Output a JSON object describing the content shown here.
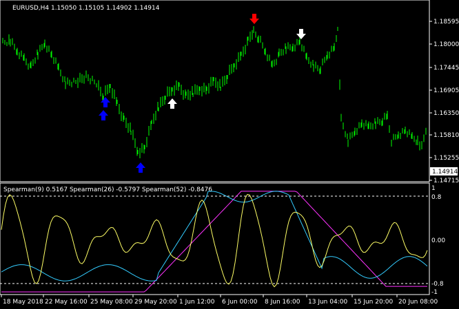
{
  "main": {
    "header": "EURUSD,H4  1.15050 1.15105 1.14902 1.14914",
    "price_scale": [
      "1.18595",
      "1.18000",
      "1.17445",
      "1.16905",
      "1.16350",
      "1.15810",
      "1.15255",
      "1.14715"
    ],
    "current_price": "1.14914",
    "colors": {
      "candle": "#00ff00",
      "background": "#000000",
      "axis": "#ffffff"
    },
    "arrows": [
      {
        "kind": "buy-signal",
        "color": "#0000ff",
        "at": "25 May"
      },
      {
        "kind": "buy-signal",
        "color": "#0000ff",
        "at": "25 May"
      },
      {
        "kind": "buy-signal",
        "color": "#0000ff",
        "at": "29 May"
      },
      {
        "kind": "buy-signal",
        "color": "#ffffff",
        "at": "31 May"
      },
      {
        "kind": "sell-signal",
        "color": "#ff0000",
        "at": "6 Jun"
      },
      {
        "kind": "sell-signal",
        "color": "#ffffff",
        "at": "8 Jun"
      }
    ]
  },
  "indicator": {
    "header": "Spearman(9) 0.5167  Spearman(26) -0.5797  Spearman(52) -0.8476",
    "scale": [
      "1",
      "0.8",
      "0.00",
      "-0.8",
      "-1"
    ],
    "series_colors": {
      "spearman9": "#ffff66",
      "spearman26": "#33ccff",
      "spearman52": "#ff33ff"
    }
  },
  "time_axis": [
    "18 May 2018",
    "22 May 16:00",
    "25 May 08:00",
    "29 May 20:00",
    "1 Jun 12:00",
    "6 Jun 00:00",
    "8 Jun 16:00",
    "13 Jun 04:00",
    "15 Jun 20:00",
    "20 Jun 08:00"
  ]
}
